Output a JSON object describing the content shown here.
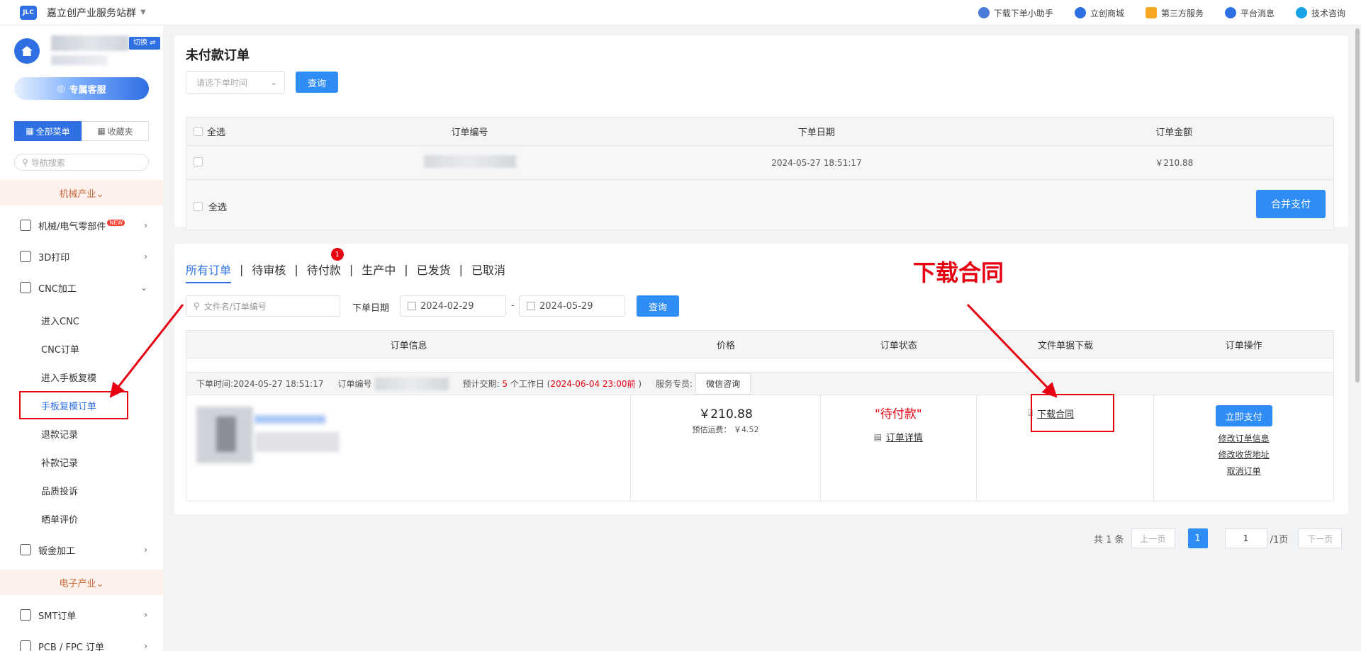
{
  "topbar": {
    "site_name": "嘉立创产业服务站群",
    "links": [
      {
        "label": "下载下单小助手",
        "icon": "assistant-icon",
        "color": "#4a7bd8"
      },
      {
        "label": "立创商城",
        "icon": "mall-icon",
        "color": "#2f6fe4"
      },
      {
        "label": "第三方服务",
        "icon": "grid-icon",
        "color": "#f5a623"
      },
      {
        "label": "平台消息",
        "icon": "bell-icon",
        "color": "#2f6fe4"
      },
      {
        "label": "技术咨询",
        "icon": "chat-icon",
        "color": "#1aa3e8"
      }
    ]
  },
  "sidebar": {
    "switch_label": "切换 ⇌",
    "service_label": "专属客服",
    "menu_tabs": [
      "全部菜单",
      "收藏夹"
    ],
    "search_placeholder": "导航搜索",
    "cat_mechanical": "机械产业⌄",
    "cat_electronic": "电子产业⌄",
    "items": [
      {
        "label": "机械/电气零部件",
        "badge": "NEW"
      },
      {
        "label": "3D打印"
      },
      {
        "label": "CNC加工"
      },
      {
        "label": "钣金加工"
      },
      {
        "label": "SMT订单"
      },
      {
        "label": "PCB / FPC 订单"
      }
    ],
    "sub_items": [
      "进入CNC",
      "CNC订单",
      "进入手板复模",
      "手板复模订单",
      "退款记录",
      "补款记录",
      "品质投诉",
      "晒单评价"
    ]
  },
  "unpaid": {
    "title": "未付款订单",
    "select_placeholder": "请选下单时间",
    "query_label": "查询",
    "headers": [
      "全选",
      "订单编号",
      "下单日期",
      "订单金额"
    ],
    "row": {
      "date": "2024-05-27 18:51:17",
      "amount": "￥210.88"
    },
    "footer_select_all": "全选",
    "merge_pay_label": "合并支付"
  },
  "orders": {
    "tabs": [
      "所有订单",
      "待审核",
      "待付款",
      "生产中",
      "已发货",
      "已取消"
    ],
    "pending_badge": "1",
    "search_placeholder": "文件名/订单编号",
    "date_label": "下单日期",
    "date_from": "2024-02-29",
    "date_sep": "-",
    "date_to": "2024-05-29",
    "query_label": "查询",
    "headers": [
      "订单信息",
      "价格",
      "订单状态",
      "文件单据下载",
      "订单操作"
    ],
    "info": {
      "order_time": "下单时间:2024-05-27 18:51:17",
      "order_no_label": "订单编号",
      "delivery_prefix": "预计交期:",
      "delivery_days": "5",
      "delivery_mid": "个工作日 (",
      "delivery_date": "2024-06-04 23:00前",
      "delivery_suffix": ")",
      "service_label": "服务专员:",
      "wechat_label": "微信咨询"
    },
    "price": "￥210.88",
    "shipping": "预估运费： ￥4.52",
    "status": "\"待付款\"",
    "detail_link": "订单详情",
    "download_contract": "下载合同",
    "pay_now": "立即支付",
    "actions": [
      "修改订单信息",
      "修改收货地址",
      "取消订单"
    ]
  },
  "annotation": "下载合同",
  "pager": {
    "total": "共 1 条",
    "prev": "上一页",
    "current": "1",
    "page_input": "1",
    "page_total": "/1页",
    "next": "下一页"
  },
  "colors": {
    "primary": "#2f6fe4",
    "annotation_red": "#e60012",
    "button_blue": "#2f8df7"
  }
}
